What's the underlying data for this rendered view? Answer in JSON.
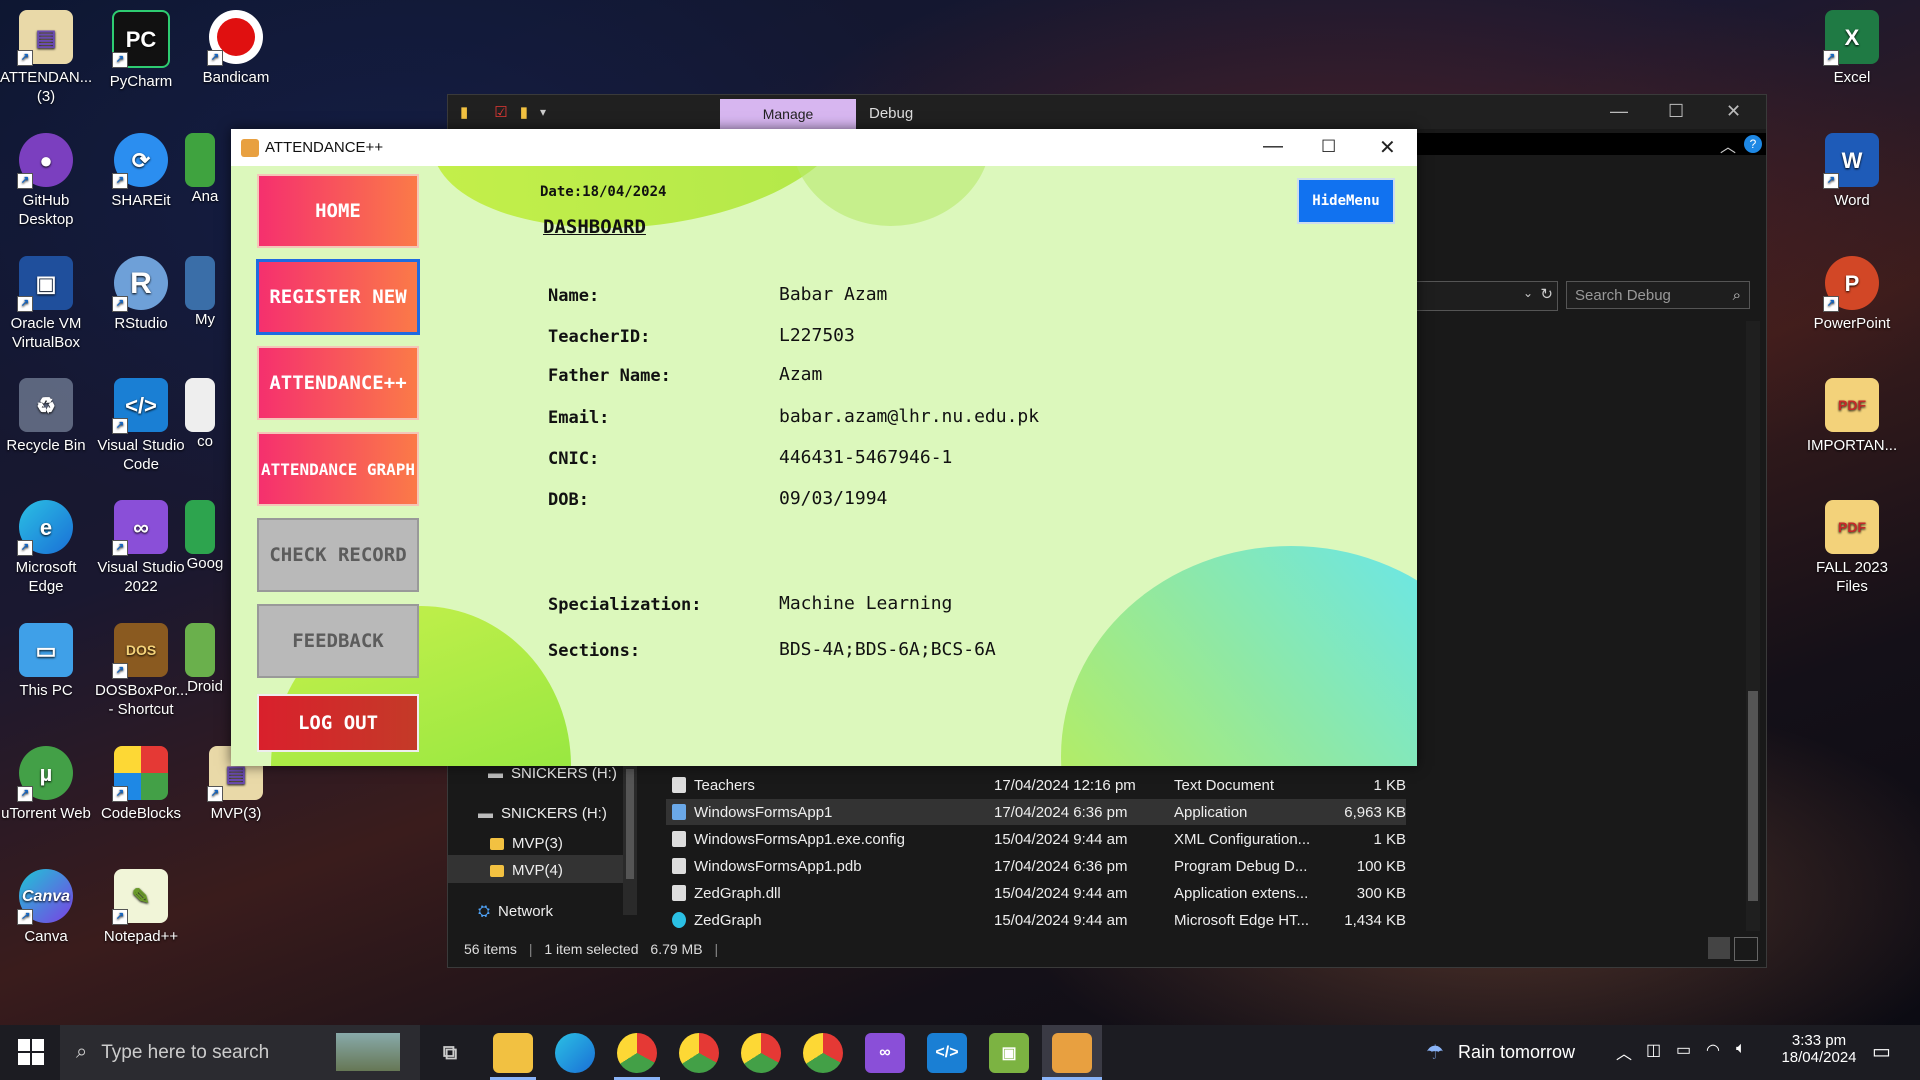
{
  "desktop_left": [
    {
      "label": "ATTENDAN...\n(3)",
      "icon": "folder-icon"
    },
    {
      "label": "PyCharm",
      "icon": "pycharm-icon"
    },
    {
      "label": "Bandicam",
      "icon": "bandicam-icon"
    },
    {
      "label": "GitHub\nDesktop",
      "icon": "github-icon"
    },
    {
      "label": "SHAREit",
      "icon": "shareit-icon"
    },
    {
      "label": "Ana",
      "icon": "anaconda-icon"
    },
    {
      "label": "Oracle VM\nVirtualBox",
      "icon": "virtualbox-icon"
    },
    {
      "label": "RStudio",
      "icon": "rstudio-icon"
    },
    {
      "label": "My",
      "icon": "mysql-icon"
    },
    {
      "label": "Recycle Bin",
      "icon": "recycle-bin-icon"
    },
    {
      "label": "Visual Studio\nCode",
      "icon": "vscode-icon"
    },
    {
      "label": "co",
      "icon": "document-icon"
    },
    {
      "label": "Microsoft\nEdge",
      "icon": "edge-icon"
    },
    {
      "label": "Visual Studio\n2022",
      "icon": "visual-studio-icon"
    },
    {
      "label": "Goog",
      "icon": "google-icon"
    },
    {
      "label": "This PC",
      "icon": "this-pc-icon"
    },
    {
      "label": "DOSBoxPor...\n- Shortcut",
      "icon": "dosbox-icon"
    },
    {
      "label": "Droid",
      "icon": "droid-icon"
    },
    {
      "label": "uTorrent Web",
      "icon": "utorrent-icon"
    },
    {
      "label": "CodeBlocks",
      "icon": "codeblocks-icon"
    },
    {
      "label": "MVP(3)",
      "icon": "folder-icon"
    },
    {
      "label": "Canva",
      "icon": "canva-icon"
    },
    {
      "label": "Notepad++",
      "icon": "notepadpp-icon"
    }
  ],
  "desktop_right": [
    {
      "label": "Excel",
      "icon": "excel-icon"
    },
    {
      "label": "Word",
      "icon": "word-icon"
    },
    {
      "label": "PowerPoint",
      "icon": "powerpoint-icon"
    },
    {
      "label": "IMPORTAN...",
      "icon": "pdf-folder-icon"
    },
    {
      "label": "FALL 2023\nFiles",
      "icon": "pdf-folder-icon"
    }
  ],
  "explorer": {
    "tab_manage": "Manage",
    "tab_debug": "Debug",
    "search_placeholder": "Search Debug",
    "nav": [
      "SNICKERS (H:)",
      "SNICKERS (H:)",
      "MVP(3)",
      "MVP(4)",
      "Network"
    ],
    "files": [
      {
        "name": "Teachers",
        "date": "17/04/2024 12:16 pm",
        "type": "Text Document",
        "size": "1 KB"
      },
      {
        "name": "WindowsFormsApp1",
        "date": "17/04/2024 6:36 pm",
        "type": "Application",
        "size": "6,963 KB"
      },
      {
        "name": "WindowsFormsApp1.exe.config",
        "date": "15/04/2024 9:44 am",
        "type": "XML Configuration...",
        "size": "1 KB"
      },
      {
        "name": "WindowsFormsApp1.pdb",
        "date": "17/04/2024 6:36 pm",
        "type": "Program Debug D...",
        "size": "100 KB"
      },
      {
        "name": "ZedGraph.dll",
        "date": "15/04/2024 9:44 am",
        "type": "Application extens...",
        "size": "300 KB"
      },
      {
        "name": "ZedGraph",
        "date": "15/04/2024 9:44 am",
        "type": "Microsoft Edge HT...",
        "size": "1,434 KB"
      }
    ],
    "status": {
      "items": "56 items",
      "selected": "1 item selected",
      "size": "6.79 MB"
    }
  },
  "app": {
    "title": "ATTENDANCE++",
    "menu": {
      "home": "HOME",
      "register": "REGISTER NEW",
      "attendance": "ATTENDANCE++",
      "graph": "ATTENDANCE GRAPH",
      "check": "CHECK RECORD",
      "feedback": "FEEDBACK",
      "logout": "LOG OUT"
    },
    "date": "Date:18/04/2024",
    "heading": "DASHBOARD",
    "hide_menu": "HideMenu",
    "fields": {
      "name_label": "Name:",
      "name": "Babar Azam",
      "id_label": "TeacherID:",
      "id": "L227503",
      "father_label": "Father Name:",
      "father": "Azam",
      "email_label": "Email:",
      "email": "babar.azam@lhr.nu.edu.pk",
      "cnic_label": "CNIC:",
      "cnic": "446431-5467946-1",
      "dob_label": "DOB:",
      "dob": "09/03/1994",
      "spec_label": "Specialization:",
      "spec": "Machine Learning",
      "sections_label": "Sections:",
      "sections": "BDS-4A;BDS-6A;BCS-6A"
    }
  },
  "taskbar": {
    "search_placeholder": "Type here to search",
    "weather": "Rain tomorrow",
    "time": "3:33 pm",
    "date": "18/04/2024"
  }
}
